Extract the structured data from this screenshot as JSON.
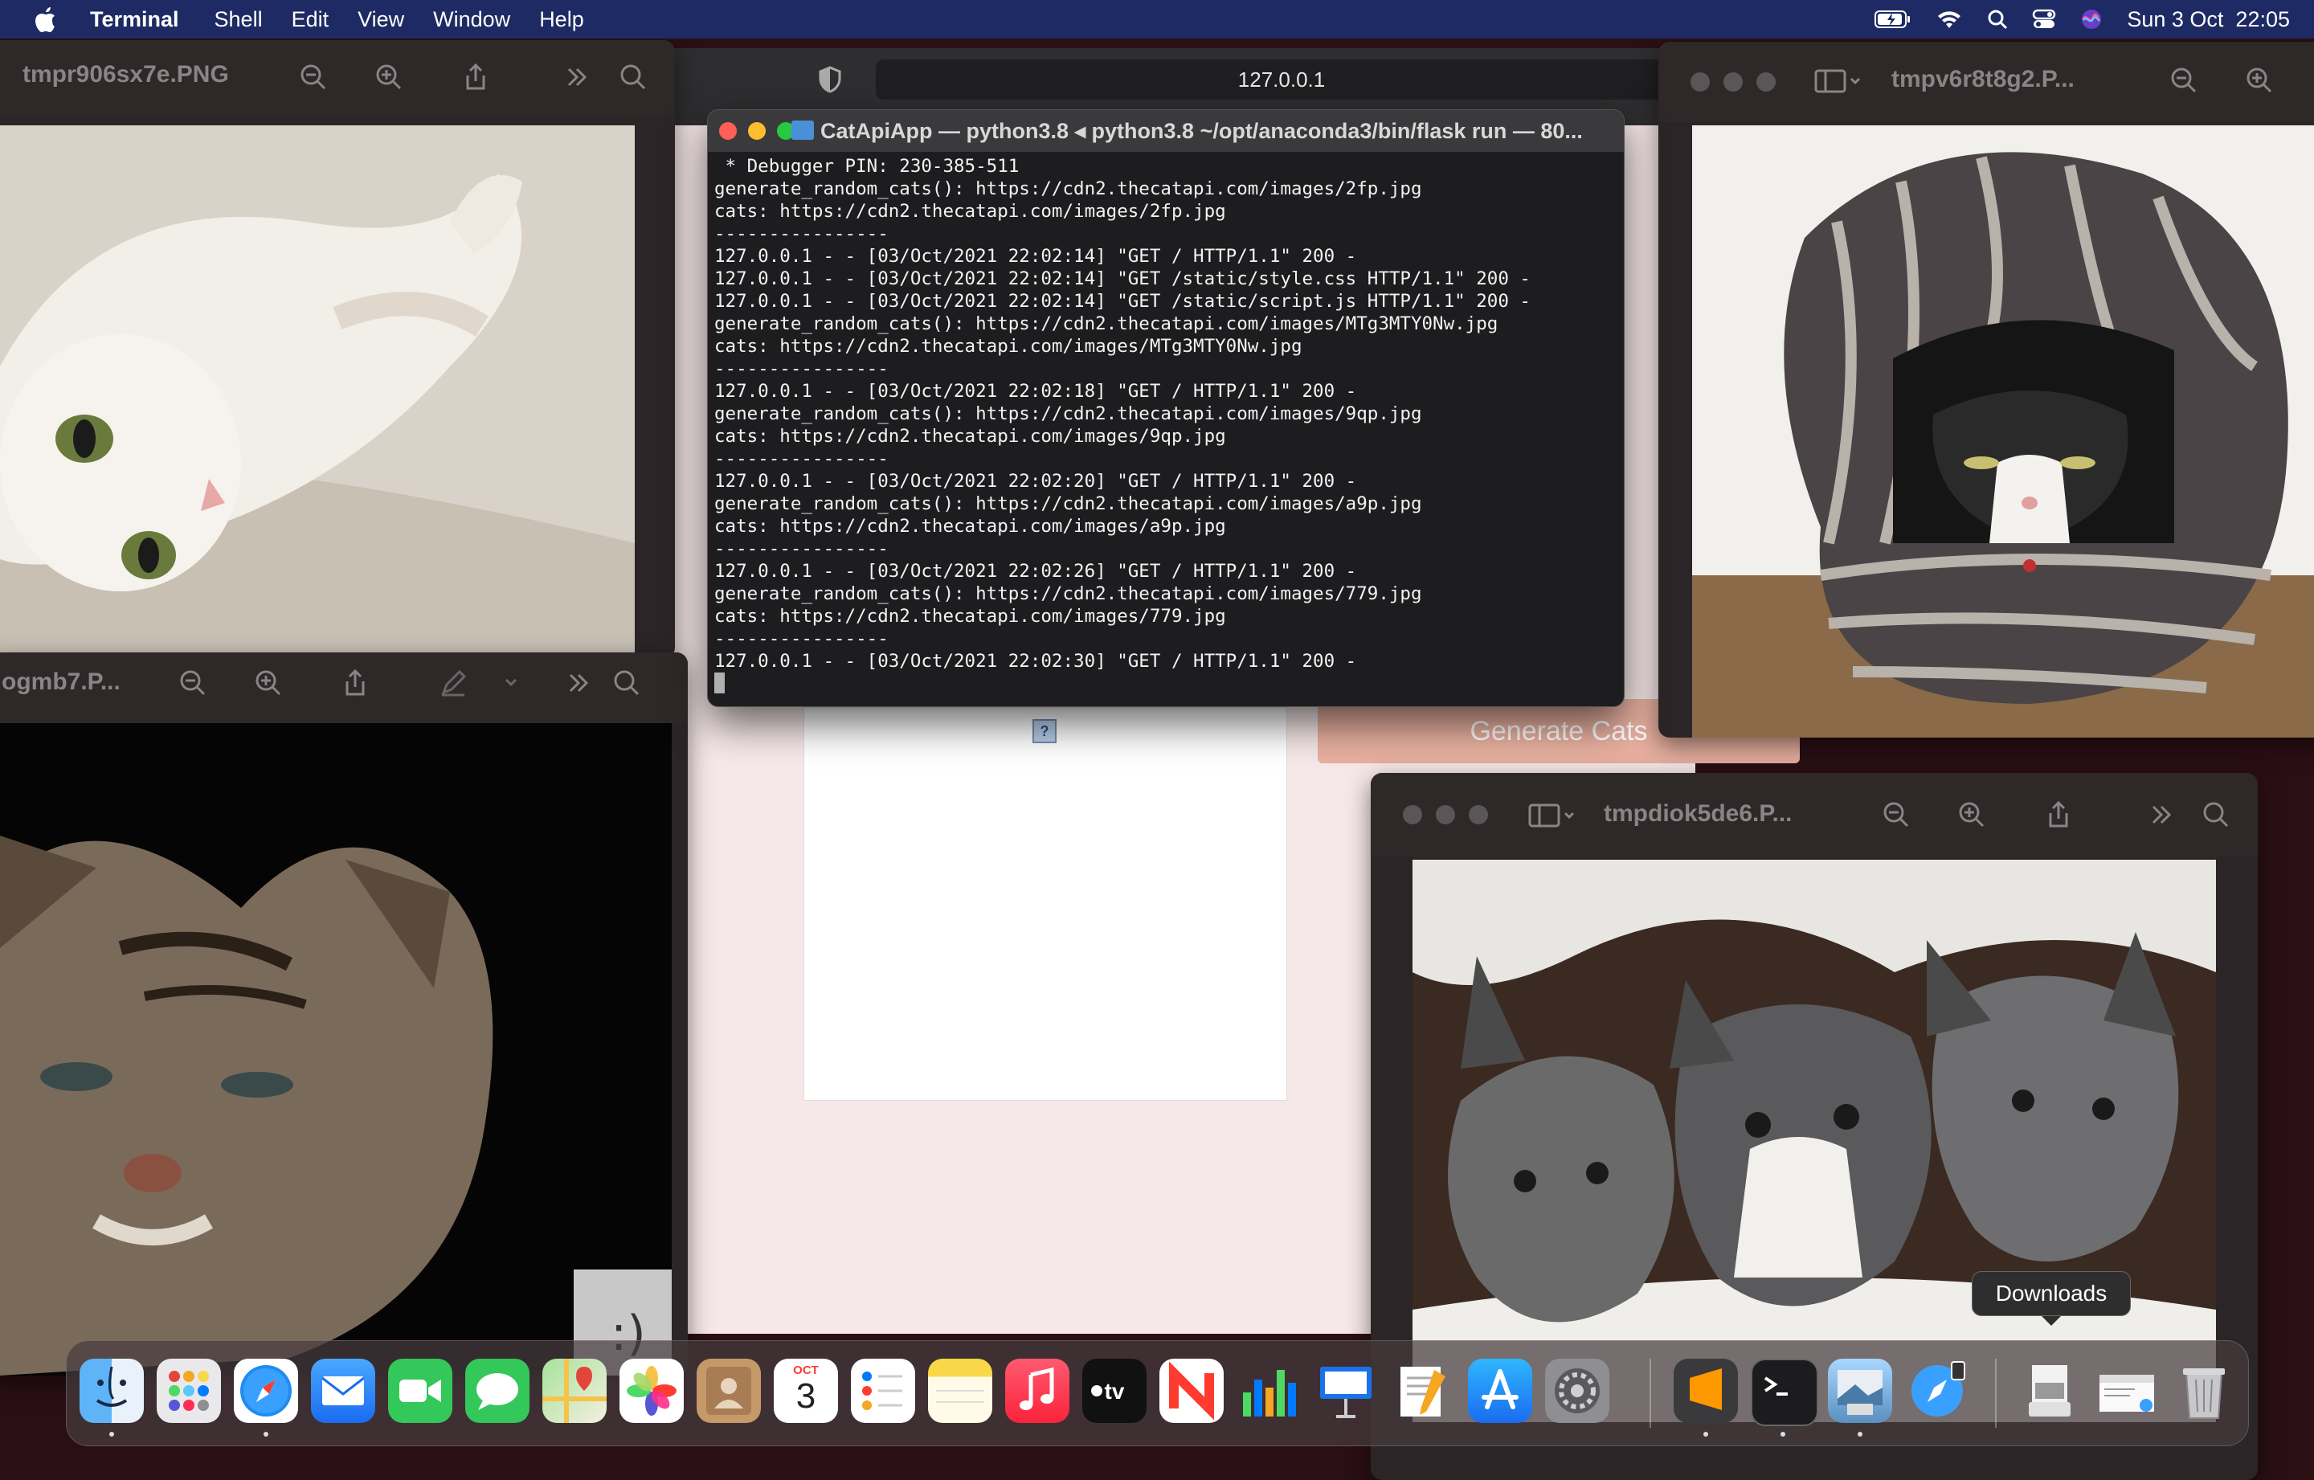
{
  "menubar": {
    "app_name": "Terminal",
    "items": [
      "Shell",
      "Edit",
      "View",
      "Window",
      "Help"
    ],
    "datetime": "Sun 3 Oct  22:05"
  },
  "browser": {
    "url": "127.0.0.1",
    "button_label": "Generate Cats",
    "broken_image_glyph": "?"
  },
  "preview_windows": [
    {
      "title": "tmpr906sx7e.PNG"
    },
    {
      "title": "ogmb7.P..."
    },
    {
      "title": "tmpv6r8t8g2.P..."
    },
    {
      "title": "tmpdiok5de6.P..."
    }
  ],
  "terminal": {
    "title": "CatApiApp — python3.8 ◂ python3.8 ~/opt/anaconda3/bin/flask run — 80...",
    "lines": [
      " * Debugger PIN: 230-385-511",
      "generate_random_cats(): https://cdn2.thecatapi.com/images/2fp.jpg",
      "cats: https://cdn2.thecatapi.com/images/2fp.jpg",
      "----------------",
      "127.0.0.1 - - [03/Oct/2021 22:02:14] \"GET / HTTP/1.1\" 200 -",
      "127.0.0.1 - - [03/Oct/2021 22:02:14] \"GET /static/style.css HTTP/1.1\" 200 -",
      "127.0.0.1 - - [03/Oct/2021 22:02:14] \"GET /static/script.js HTTP/1.1\" 200 -",
      "generate_random_cats(): https://cdn2.thecatapi.com/images/MTg3MTY0Nw.jpg",
      "cats: https://cdn2.thecatapi.com/images/MTg3MTY0Nw.jpg",
      "----------------",
      "127.0.0.1 - - [03/Oct/2021 22:02:18] \"GET / HTTP/1.1\" 200 -",
      "generate_random_cats(): https://cdn2.thecatapi.com/images/9qp.jpg",
      "cats: https://cdn2.thecatapi.com/images/9qp.jpg",
      "----------------",
      "127.0.0.1 - - [03/Oct/2021 22:02:20] \"GET / HTTP/1.1\" 200 -",
      "generate_random_cats(): https://cdn2.thecatapi.com/images/a9p.jpg",
      "cats: https://cdn2.thecatapi.com/images/a9p.jpg",
      "----------------",
      "127.0.0.1 - - [03/Oct/2021 22:02:26] \"GET / HTTP/1.1\" 200 -",
      "generate_random_cats(): https://cdn2.thecatapi.com/images/779.jpg",
      "cats: https://cdn2.thecatapi.com/images/779.jpg",
      "----------------",
      "127.0.0.1 - - [03/Oct/2021 22:02:30] \"GET / HTTP/1.1\" 200 -"
    ]
  },
  "dock": {
    "tooltip": "Downloads",
    "calendar_month": "OCT",
    "calendar_day": "3",
    "apps": [
      "finder-icon",
      "launchpad-icon",
      "safari-icon",
      "mail-icon",
      "facetime-icon",
      "messages-icon",
      "maps-icon",
      "photos-icon",
      "contacts-icon",
      "calendar-icon",
      "reminders-icon",
      "notes-icon",
      "music-icon",
      "tv-icon",
      "news-icon",
      "numbers-icon",
      "keynote-icon",
      "pages-icon",
      "app-store-icon",
      "system-preferences-icon",
      "sublime-text-icon",
      "terminal-icon",
      "preview-icon",
      "safari-download-icon",
      "downloads-stack-icon",
      "documents-stack-icon",
      "trash-icon"
    ]
  },
  "colors": {
    "menubar": "#1e2a63",
    "browser_bg": "#f6e8e8",
    "button": "#e8b0a0",
    "terminal_bg": "#1d1d1f",
    "desktop": "#2a0f14"
  }
}
